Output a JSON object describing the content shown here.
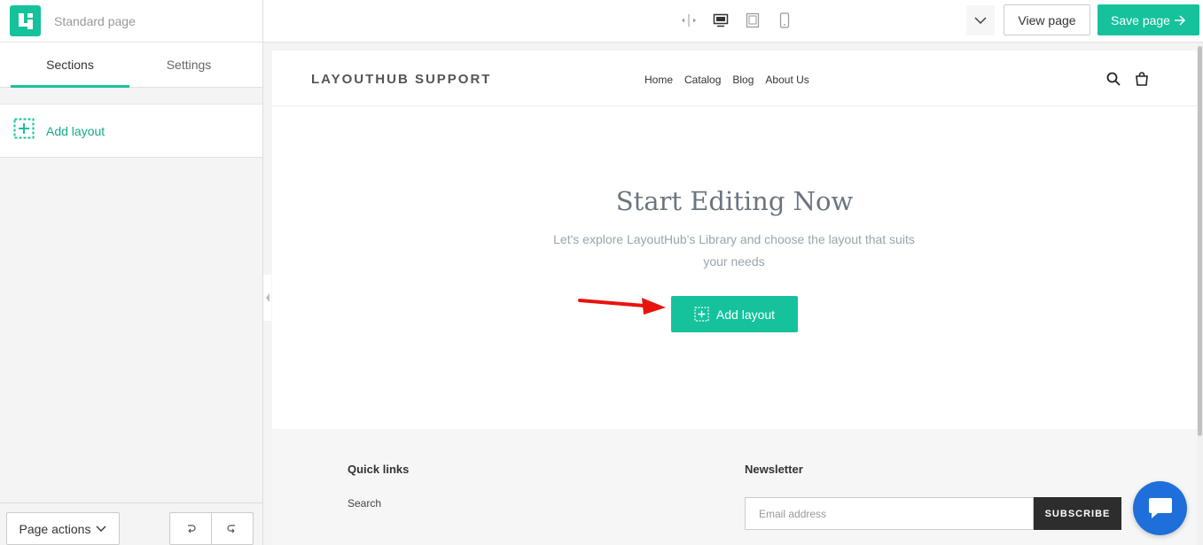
{
  "app": {
    "page_name": "Standard page",
    "logo_icon": "layouthub-logo-icon",
    "accent_color": "#15c29c"
  },
  "sidebar": {
    "tabs": [
      {
        "label": "Sections",
        "active": true
      },
      {
        "label": "Settings",
        "active": false
      }
    ],
    "add_layout_label": "Add layout",
    "page_actions_label": "Page actions"
  },
  "toolbar": {
    "device_icons": [
      "fit-width-icon",
      "desktop-icon",
      "tablet-icon",
      "mobile-icon"
    ],
    "view_label": "View page",
    "save_label": "Save page"
  },
  "preview": {
    "brand": "LAYOUTHUB SUPPORT",
    "nav": [
      "Home",
      "Catalog",
      "Blog",
      "About Us"
    ],
    "hero_title": "Start Editing Now",
    "hero_subtitle": "Let's explore LayoutHub's Library and choose the layout that suits your needs",
    "hero_button": "Add layout",
    "footer": {
      "quick_links_title": "Quick links",
      "quick_links": [
        "Search"
      ],
      "newsletter_title": "Newsletter",
      "email_placeholder": "Email address",
      "subscribe_label": "SUBSCRIBE"
    }
  }
}
